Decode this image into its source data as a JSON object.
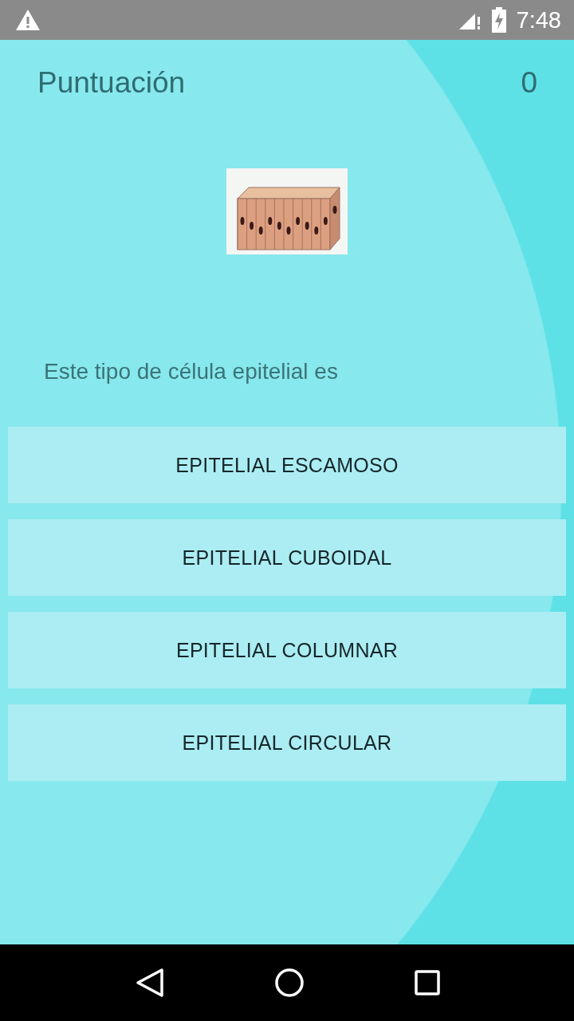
{
  "status_bar": {
    "time": "7:48"
  },
  "score": {
    "label": "Puntuación",
    "value": "0"
  },
  "question": {
    "text": "Este tipo de célula epitelial es"
  },
  "options": [
    {
      "label": "EPITELIAL ESCAMOSO"
    },
    {
      "label": "EPITELIAL CUBOIDAL"
    },
    {
      "label": "EPITELIAL COLUMNAR"
    },
    {
      "label": "EPITELIAL CIRCULAR"
    }
  ]
}
